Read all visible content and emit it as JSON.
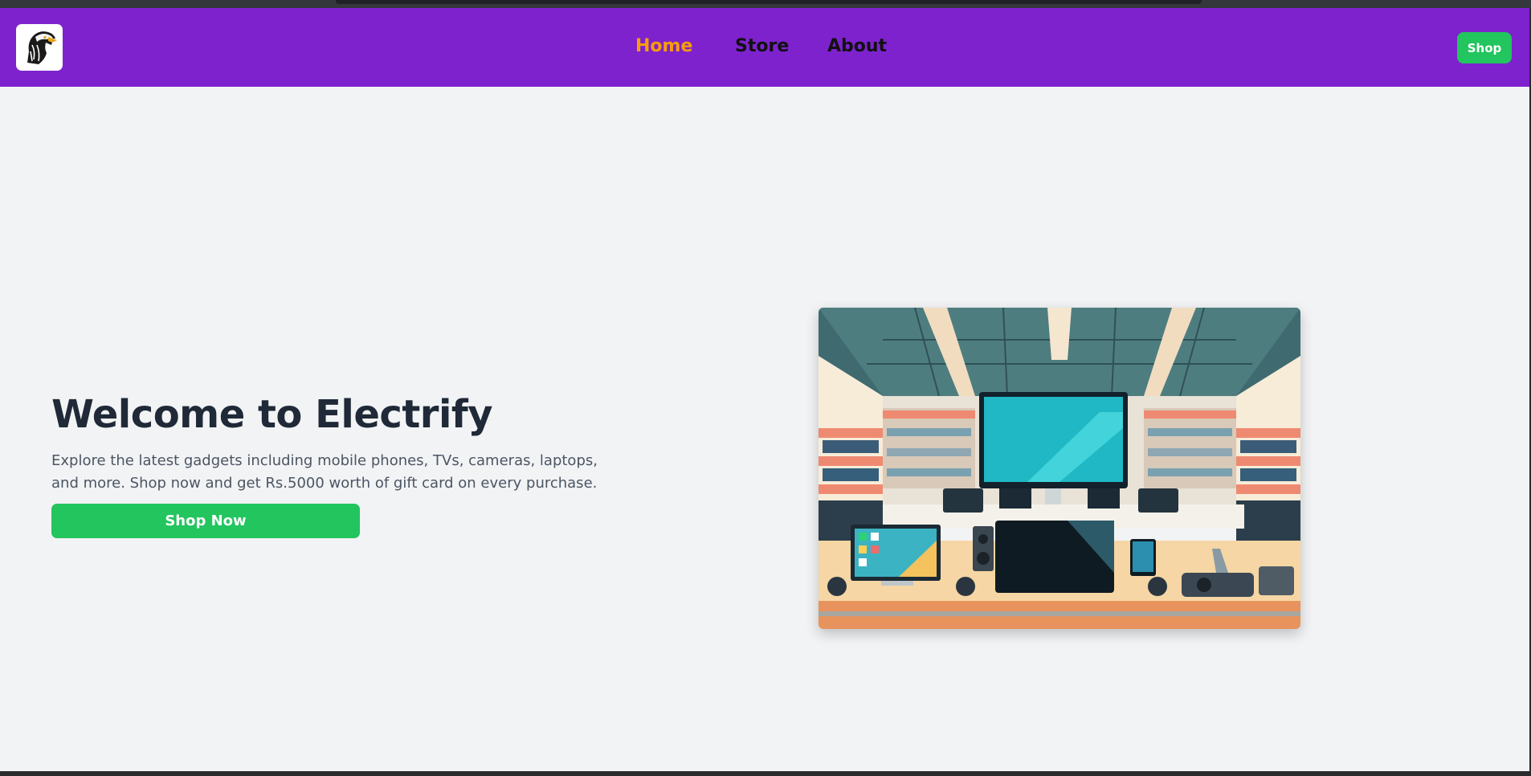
{
  "nav": {
    "logo_icon": "eagle-head-icon",
    "links": [
      {
        "label": "Home",
        "active": true
      },
      {
        "label": "Store",
        "active": false
      },
      {
        "label": "About",
        "active": false
      }
    ],
    "shop_button": "Shop"
  },
  "hero": {
    "title": "Welcome to Electrify",
    "description": "Explore the latest gadgets including mobile phones, TVs, cameras, laptops, and more. Shop now and get Rs.5000 worth of gift card on every purchase.",
    "cta_label": "Shop Now",
    "image_icon": "electronics-store-illustration"
  },
  "colors": {
    "navbar": "#7e22ce",
    "active_link": "#f59e0b",
    "button": "#22c55e",
    "page_bg": "#f2f3f5",
    "title": "#1f2937"
  }
}
